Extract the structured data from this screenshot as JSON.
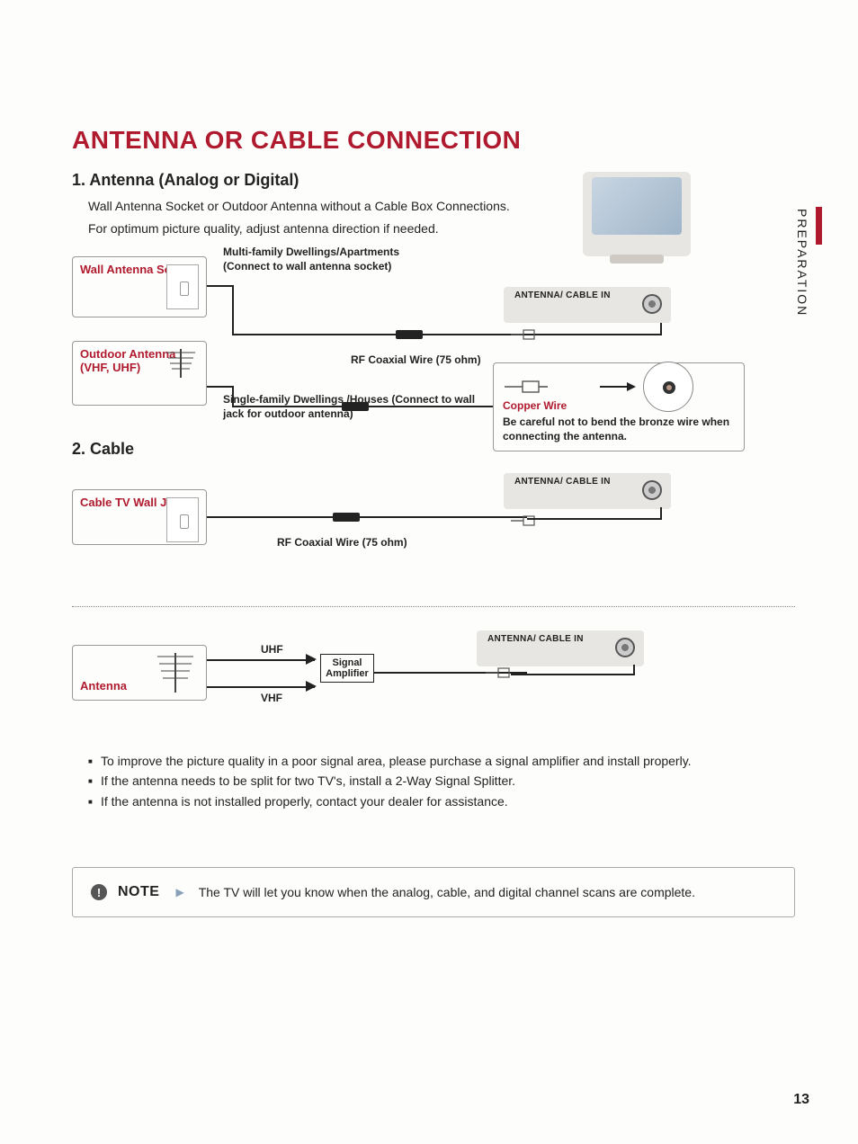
{
  "sidebar": {
    "section": "PREPARATION"
  },
  "page_number": "13",
  "title": "ANTENNA OR CABLE CONNECTION",
  "section1": {
    "heading": "1. Antenna (Analog or Digital)",
    "intro1": "Wall Antenna Socket or Outdoor Antenna without a Cable Box Connections.",
    "intro2": "For optimum picture quality, adjust antenna direction if needed.",
    "wall_socket_label": "Wall Antenna Socket",
    "outdoor_label": "Outdoor Antenna (VHF, UHF)",
    "multi_label": "Multi-family Dwellings/Apartments (Connect to wall antenna socket)",
    "single_label": "Single-family Dwellings /Houses (Connect to wall jack for outdoor antenna)",
    "rf_label": "RF Coaxial Wire (75 ohm)",
    "panel_label": "ANTENNA/ CABLE IN",
    "copper_wire": "Copper Wire",
    "warning": "Be careful not to bend the bronze wire when connecting the antenna."
  },
  "section2": {
    "heading": "2. Cable",
    "cable_jack_label": "Cable TV Wall Jack",
    "rf_label": "RF Coaxial Wire (75 ohm)",
    "panel_label": "ANTENNA/ CABLE IN"
  },
  "section3": {
    "antenna_label": "Antenna",
    "uhf": "UHF",
    "vhf": "VHF",
    "amp": "Signal Amplifier",
    "panel_label": "ANTENNA/ CABLE IN",
    "bullets": [
      "To improve the picture quality in a poor signal area, please purchase a signal amplifier and install properly.",
      "If the antenna needs to be split for two TV's, install a 2-Way Signal Splitter.",
      "If the antenna is not installed properly, contact your dealer for assistance."
    ]
  },
  "note": {
    "label": "NOTE",
    "text": "The TV will let you know when the analog, cable, and digital channel scans are complete."
  }
}
